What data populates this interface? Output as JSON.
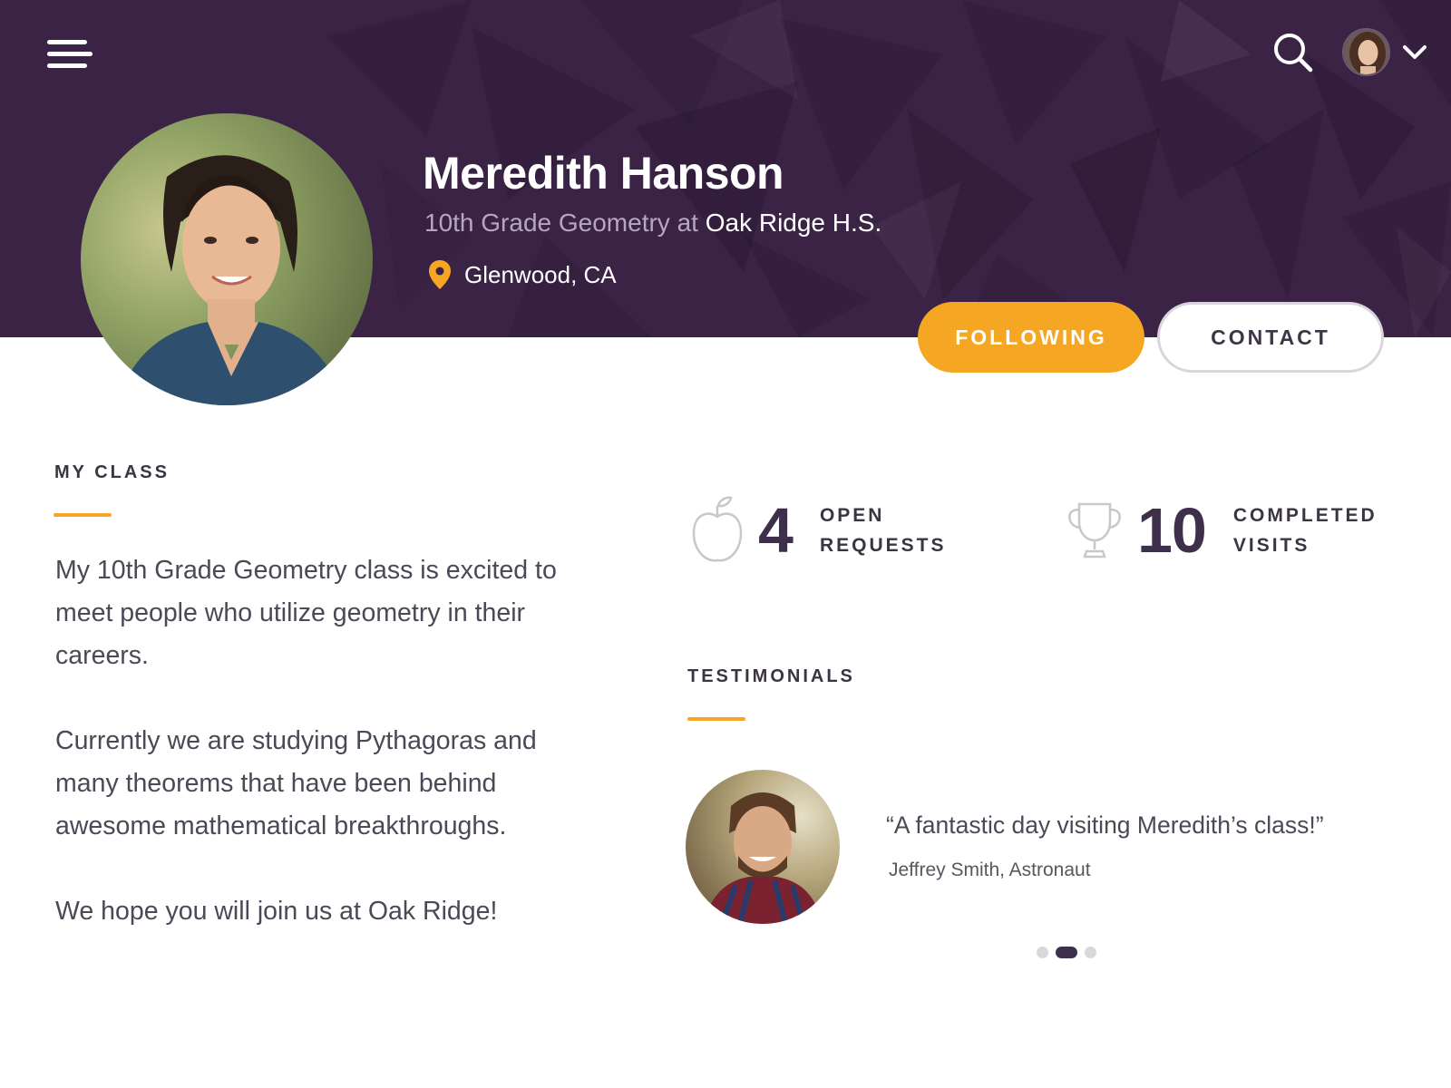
{
  "colors": {
    "header_bg": "#3b2346",
    "accent": "#f5a623",
    "primary_text": "#3b3541",
    "stat_number": "#3e2f4a"
  },
  "header": {
    "menu_icon": "hamburger-menu-icon",
    "search_icon": "search-icon",
    "user_menu_icon": "chevron-down-icon"
  },
  "profile": {
    "name": "Meredith Hanson",
    "role": "10th Grade Geometry at",
    "school": "Oak Ridge H.S.",
    "location_icon": "map-pin-icon",
    "location": "Glenwood, CA",
    "follow_label": "FOLLOWING",
    "contact_label": "CONTACT"
  },
  "my_class": {
    "heading": "MY CLASS",
    "paragraphs": [
      "My 10th Grade Geometry class is excited to meet people who utilize geometry in their careers.",
      "Currently we are studying Pythagoras and many theorems that have been behind awesome mathematical breakthroughs.",
      "We hope you will join us at Oak Ridge!"
    ]
  },
  "stats": [
    {
      "icon": "apple-icon",
      "value": "4",
      "label_line1": "OPEN",
      "label_line2": "REQUESTS"
    },
    {
      "icon": "trophy-icon",
      "value": "10",
      "label_line1": "COMPLETED",
      "label_line2": "VISITS"
    }
  ],
  "testimonials": {
    "heading": "TESTIMONIALS",
    "quote": "“A fantastic day visiting Meredith’s class!”",
    "author": "Jeffrey Smith, Astronaut",
    "carousel_total": 3,
    "carousel_active": 2
  }
}
